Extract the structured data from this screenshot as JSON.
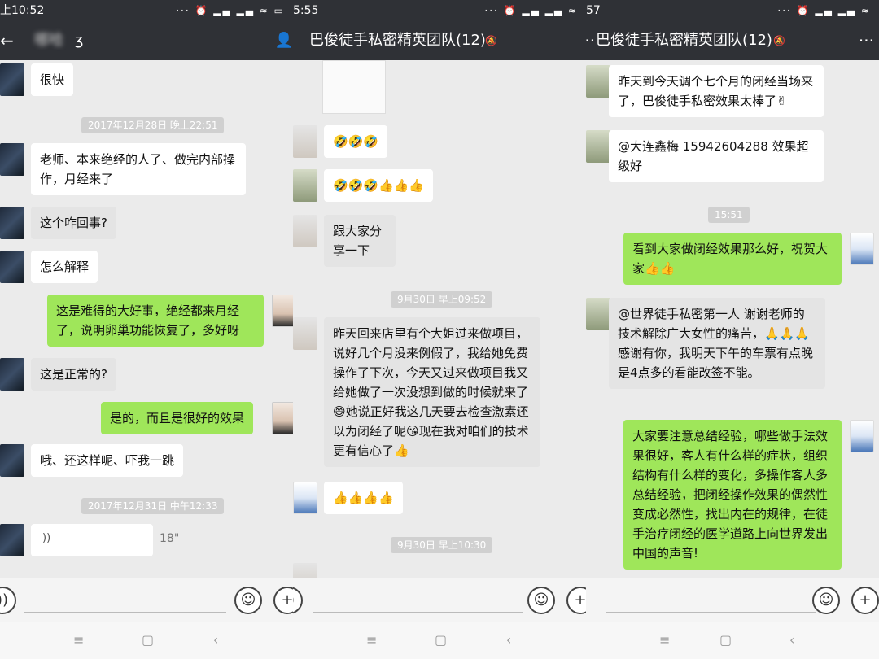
{
  "panel1": {
    "status_time": "上10:52",
    "status_icons": "··· ⏰ ▂▄ ▂▄ ≈ ▭",
    "title": "哪哈",
    "earpiece_icon": "ear-icon",
    "messages": [
      {
        "text": "很快"
      },
      {
        "ts": "2017年12月28日 晚上22:51"
      },
      {
        "text": "老师、本来绝经的人了、做完内部操作，月经来了"
      },
      {
        "text": "这个咋回事?"
      },
      {
        "text": "怎么解释"
      },
      {
        "text": "这是难得的大好事，绝经都来月经了，说明卵巢功能恢复了，多好呀"
      },
      {
        "text": "这是正常的?"
      },
      {
        "text": "是的，而且是很好的效果"
      },
      {
        "text": "哦、还这样呢、吓我一跳"
      },
      {
        "ts": "2017年12月31日 中午12:33"
      },
      {
        "voice_len": "18\""
      }
    ]
  },
  "panel2": {
    "status_time": "5:55",
    "status_icons": "··· ⏰ ▂▄ ▂▄ ≈",
    "title": "巴俊徒手私密精英团队(12)",
    "messages": [
      {
        "text": "🤣🤣🤣"
      },
      {
        "text": "🤣🤣🤣👍👍👍"
      },
      {
        "text": "跟大家分享一下"
      },
      {
        "ts": "9月30日 早上09:52"
      },
      {
        "text": "昨天回来店里有个大姐过来做项目，说好几个月没来例假了，我给她免费操作了下次，今天又过来做项目我又给她做了一次没想到做的时候就来了😄她说正好我这几天要去检查激素还以为闭经了呢😘现在我对咱们的技术更有信心了👍"
      },
      {
        "text": "👍👍👍👍"
      },
      {
        "ts": "9月30日 早上10:30"
      }
    ]
  },
  "panel3": {
    "status_time": "57",
    "status_icons": "··· ⏰ ▂▄ ▂▄ ≈",
    "title": "巴俊徒手私密精英团队(12)",
    "messages": [
      {
        "text": "昨天到今天调个七个月的闭经当场来了，巴俊徒手私密效果太棒了✌"
      },
      {
        "text": "@大连鑫梅 15942604288 效果超级好"
      },
      {
        "ts": "15:51"
      },
      {
        "text": "看到大家做闭经效果那么好，祝贺大家👍👍"
      },
      {
        "text": "@世界徒手私密第一人 谢谢老师的技术解除广大女性的痛苦，🙏🙏🙏感谢有你，我明天下午的车票有点晚是4点多的看能改签不能。"
      },
      {
        "text": "大家要注意总结经验，哪些做手法效果很好，客人有什么样的症状，组织结构有什么样的变化，多操作客人多总结经验，把闭经操作效果的偶然性变成必然性，找出内在的规律，在徒手治疗闭经的医学道路上向世界发出中国的声音!"
      }
    ]
  },
  "icons": {
    "back": "←",
    "person": "👤",
    "more": "···",
    "ear": "ʒ",
    "voice": "🔊",
    "smile": "☺",
    "plus": "+",
    "voice_waves": "))",
    "nav_menu": "≡",
    "nav_home": "▢",
    "nav_back": "‹"
  }
}
